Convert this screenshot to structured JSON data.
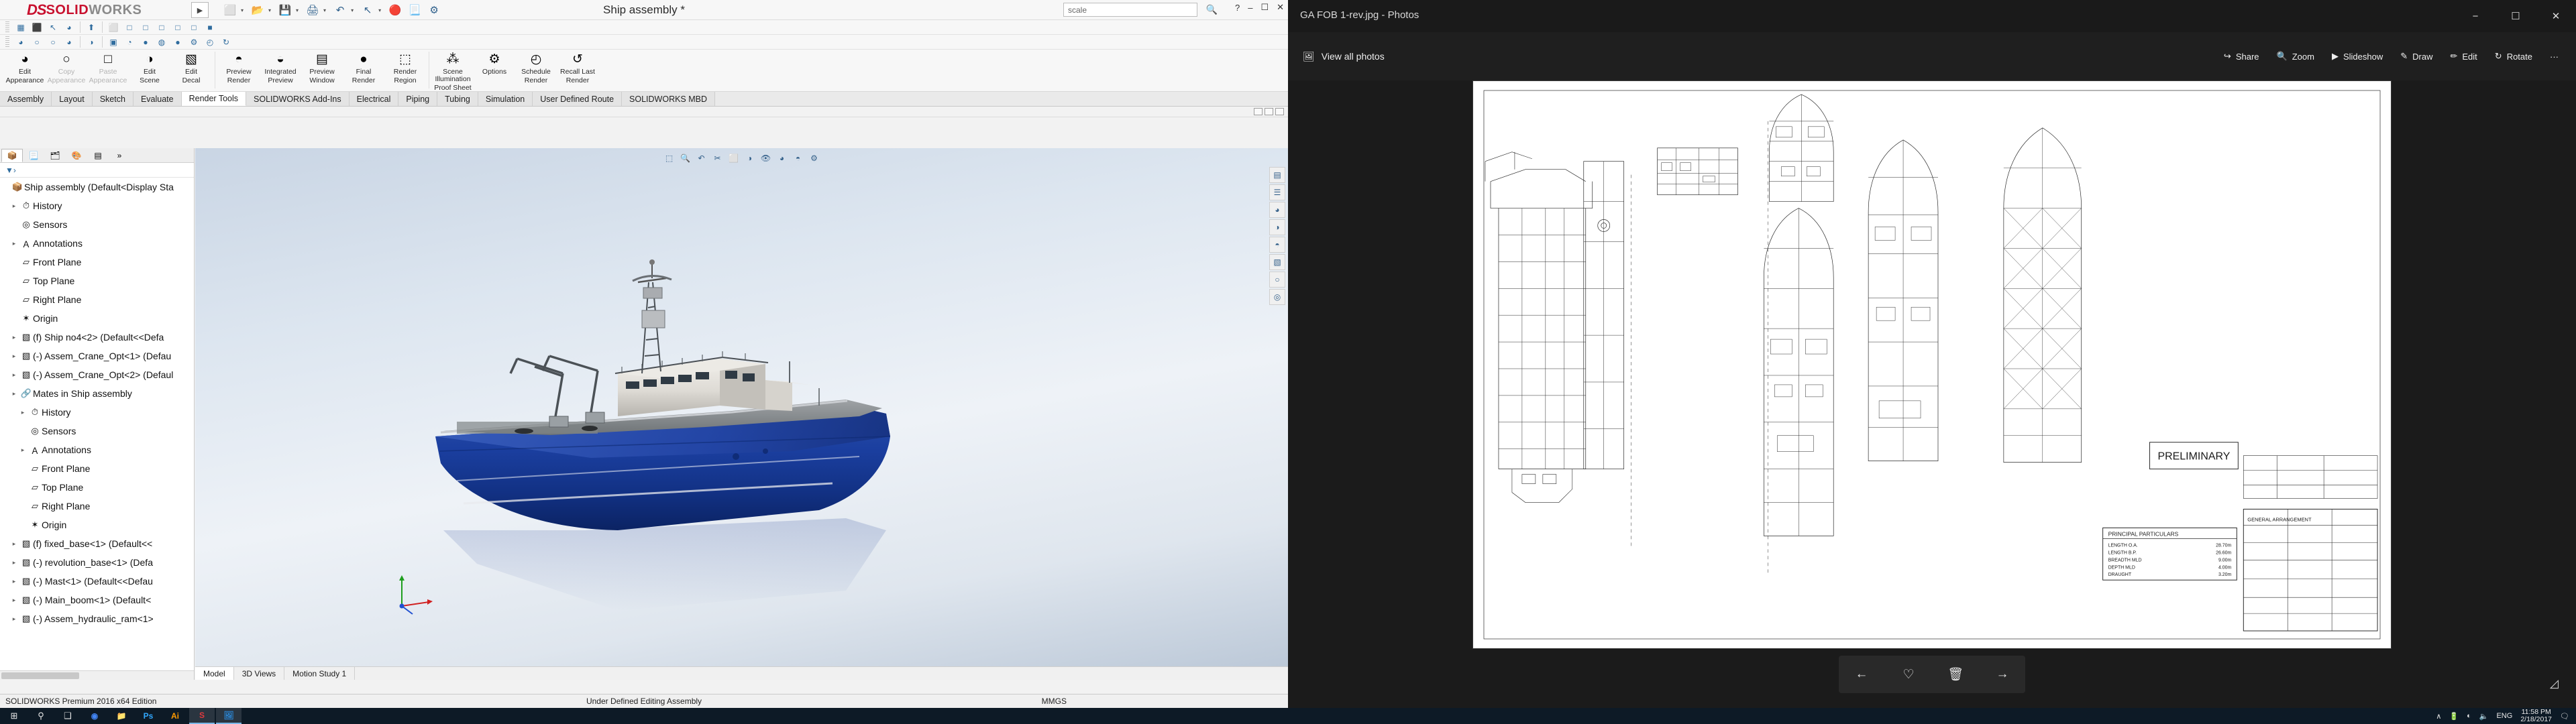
{
  "solidworks": {
    "title": "Ship assembly *",
    "logo": {
      "ds": "DS",
      "solid": "SOLID",
      "works": "WORKS"
    },
    "search_placeholder": "scale",
    "search_value": "scale",
    "window_buttons": [
      "?",
      "-",
      "❐",
      "✕"
    ],
    "quick_access": [
      {
        "name": "new-document-icon",
        "glyph": "⬜"
      },
      {
        "name": "open-document-icon",
        "glyph": "📂"
      },
      {
        "name": "save-icon",
        "glyph": "💾"
      },
      {
        "name": "print-icon",
        "glyph": "🖨"
      },
      {
        "name": "undo-icon",
        "glyph": "↶"
      },
      {
        "name": "select-icon",
        "glyph": "↖"
      },
      {
        "name": "rebuild-icon",
        "glyph": "🔴"
      },
      {
        "name": "options-list-icon",
        "glyph": "📃"
      },
      {
        "name": "settings-gear-icon",
        "glyph": "⚙"
      }
    ],
    "toolbar_row1": [
      "open-assembly-icon",
      "insert-component-icon",
      "select-pointer-icon",
      "appearance-icon",
      "normal-to-icon",
      "view-iso-icon",
      "view-front-icon",
      "view-left-icon",
      "view-right-icon",
      "view-top-icon",
      "view-bottom-icon",
      "view-shaded-icon"
    ],
    "toolbar_row2": [
      "appearance-edit-icon",
      "sphere-dim-icon",
      "bucket-dim-icon",
      "apply-appearance-icon",
      "scene-edit-icon",
      "display-state-icon",
      "scene-light-icon",
      "camera-icon",
      "lighting-icon",
      "two-spheres-icon",
      "render-settings-icon",
      "render-clock-icon",
      "render-refresh-icon"
    ],
    "ribbon": [
      {
        "label_top": "Edit",
        "label_bot": "Appearance",
        "icon": "appearance-icon",
        "dim": false
      },
      {
        "label_top": "Copy",
        "label_bot": "Appearance",
        "icon": "copy-appearance-icon",
        "dim": true
      },
      {
        "label_top": "Paste",
        "label_bot": "Appearance",
        "icon": "paste-appearance-icon",
        "dim": true
      },
      {
        "label_top": "Edit",
        "label_bot": "Scene",
        "icon": "edit-scene-icon",
        "dim": false
      },
      {
        "label_top": "Edit",
        "label_bot": "Decal",
        "icon": "edit-decal-icon",
        "dim": false
      },
      {
        "label_top": "Preview",
        "label_bot": "Render",
        "icon": "preview-render-icon",
        "dim": false
      },
      {
        "label_top": "Integrated",
        "label_bot": "Preview",
        "icon": "integrated-preview-icon",
        "dim": false
      },
      {
        "label_top": "Preview",
        "label_bot": "Window",
        "icon": "preview-window-icon",
        "dim": false
      },
      {
        "label_top": "Final",
        "label_bot": "Render",
        "icon": "final-render-icon",
        "dim": false
      },
      {
        "label_top": "Render",
        "label_bot": "Region",
        "icon": "render-region-icon",
        "dim": false
      },
      {
        "label_top": "Scene Illumination",
        "label_bot": "Proof Sheet",
        "icon": "proof-sheet-icon",
        "dim": false
      },
      {
        "label_top": "Options",
        "label_bot": "",
        "icon": "render-options-icon",
        "dim": false
      },
      {
        "label_top": "Schedule",
        "label_bot": "Render",
        "icon": "schedule-render-icon",
        "dim": false
      },
      {
        "label_top": "Recall Last",
        "label_bot": "Render",
        "icon": "recall-render-icon",
        "dim": false
      }
    ],
    "command_tabs": [
      {
        "label": "Assembly",
        "active": false
      },
      {
        "label": "Layout",
        "active": false
      },
      {
        "label": "Sketch",
        "active": false
      },
      {
        "label": "Evaluate",
        "active": false
      },
      {
        "label": "Render Tools",
        "active": true
      },
      {
        "label": "SOLIDWORKS Add-Ins",
        "active": false
      },
      {
        "label": "Electrical",
        "active": false
      },
      {
        "label": "Piping",
        "active": false
      },
      {
        "label": "Tubing",
        "active": false
      },
      {
        "label": "Simulation",
        "active": false
      },
      {
        "label": "User Defined Route",
        "active": false
      },
      {
        "label": "SOLIDWORKS MBD",
        "active": false
      }
    ],
    "tree_tabs": [
      {
        "name": "feature-manager-tab",
        "glyph": "📦",
        "active": true
      },
      {
        "name": "property-manager-tab",
        "glyph": "📃",
        "active": false
      },
      {
        "name": "configuration-manager-tab",
        "glyph": "🗂",
        "active": false
      },
      {
        "name": "display-manager-tab",
        "glyph": "🎨",
        "active": false
      },
      {
        "name": "dimxpert-tab",
        "glyph": "▤",
        "active": false
      },
      {
        "name": "tree-more-tab",
        "glyph": "»",
        "active": false
      }
    ],
    "tree_filter_placeholder": "",
    "tree": [
      {
        "indent": 0,
        "arrow": "",
        "icon": "assembly-icon",
        "label": "Ship assembly  (Default<Display Sta"
      },
      {
        "indent": 1,
        "arrow": "▸",
        "icon": "history-icon",
        "label": "History"
      },
      {
        "indent": 1,
        "arrow": "",
        "icon": "sensors-icon",
        "label": "Sensors"
      },
      {
        "indent": 1,
        "arrow": "▸",
        "icon": "annotations-icon",
        "label": "Annotations"
      },
      {
        "indent": 1,
        "arrow": "",
        "icon": "plane-icon",
        "label": "Front Plane"
      },
      {
        "indent": 1,
        "arrow": "",
        "icon": "plane-icon",
        "label": "Top Plane"
      },
      {
        "indent": 1,
        "arrow": "",
        "icon": "plane-icon",
        "label": "Right Plane"
      },
      {
        "indent": 1,
        "arrow": "",
        "icon": "origin-icon",
        "label": "Origin"
      },
      {
        "indent": 1,
        "arrow": "▸",
        "icon": "part-icon",
        "label": "(f) Ship no4<2>  (Default<<Defa"
      },
      {
        "indent": 1,
        "arrow": "▸",
        "icon": "part-icon",
        "label": "(-) Assem_Crane_Opt<1>  (Defau"
      },
      {
        "indent": 1,
        "arrow": "▸",
        "icon": "part-icon",
        "label": "(-) Assem_Crane_Opt<2>  (Defaul"
      },
      {
        "indent": 1,
        "arrow": "▸",
        "icon": "mates-icon",
        "label": "Mates in Ship assembly"
      },
      {
        "indent": 2,
        "arrow": "▸",
        "icon": "history-icon",
        "label": "History"
      },
      {
        "indent": 2,
        "arrow": "",
        "icon": "sensors-icon",
        "label": "Sensors"
      },
      {
        "indent": 2,
        "arrow": "▸",
        "icon": "annotations-icon",
        "label": "Annotations"
      },
      {
        "indent": 2,
        "arrow": "",
        "icon": "plane-icon",
        "label": "Front Plane"
      },
      {
        "indent": 2,
        "arrow": "",
        "icon": "plane-icon",
        "label": "Top Plane"
      },
      {
        "indent": 2,
        "arrow": "",
        "icon": "plane-icon",
        "label": "Right Plane"
      },
      {
        "indent": 2,
        "arrow": "",
        "icon": "origin-icon",
        "label": "Origin"
      },
      {
        "indent": 1,
        "arrow": "▸",
        "icon": "part-icon",
        "label": "(f) fixed_base<1>  (Default<<"
      },
      {
        "indent": 1,
        "arrow": "▸",
        "icon": "part-icon",
        "label": "(-) revolution_base<1>  (Defa"
      },
      {
        "indent": 1,
        "arrow": "▸",
        "icon": "part-icon",
        "label": "(-) Mast<1>  (Default<<Defau"
      },
      {
        "indent": 1,
        "arrow": "▸",
        "icon": "part-icon",
        "label": "(-) Main_boom<1>  (Default<"
      },
      {
        "indent": 1,
        "arrow": "▸",
        "icon": "part-icon",
        "label": "(-) Assem_hydraulic_ram<1> "
      }
    ],
    "viewport_tabs": [
      {
        "label": "Model",
        "active": true
      },
      {
        "label": "3D Views",
        "active": false
      },
      {
        "label": "Motion Study 1",
        "active": false
      }
    ],
    "status": {
      "left": "SOLIDWORKS Premium 2016 x64 Edition",
      "center": "Under Defined     Editing Assembly",
      "units": "MMGS"
    }
  },
  "photos": {
    "title": "GA FOB 1-rev.jpg - Photos",
    "window_buttons": [
      "−",
      "❐",
      "✕"
    ],
    "view_all_label": "View all photos",
    "view_all_icon": "photo-collection-icon",
    "actions": [
      {
        "label": "Share",
        "icon": "share-icon"
      },
      {
        "label": "Zoom",
        "icon": "zoom-icon"
      },
      {
        "label": "Slideshow",
        "icon": "slideshow-icon"
      },
      {
        "label": "Draw",
        "icon": "draw-icon"
      },
      {
        "label": "Edit",
        "icon": "edit-icon"
      },
      {
        "label": "Rotate",
        "icon": "rotate-icon"
      },
      {
        "label": "···",
        "icon": "more-icon"
      }
    ],
    "nav": [
      {
        "name": "previous-image-button",
        "glyph": "←"
      },
      {
        "name": "favorite-button",
        "glyph": "♡"
      },
      {
        "name": "delete-button",
        "glyph": "🗑"
      },
      {
        "name": "next-image-button",
        "glyph": "→"
      }
    ],
    "expand_icon": "expand-icon",
    "drawing": {
      "stamp": "PRELIMINARY",
      "particulars_title": "PRINCIPAL PARTICULARS",
      "particulars": [
        {
          "k": "LENGTH O.A.",
          "v": "28.70m"
        },
        {
          "k": "LENGTH B.P.",
          "v": "26.60m"
        },
        {
          "k": "BREADTH MLD",
          "v": "9.00m"
        },
        {
          "k": "DEPTH MLD",
          "v": "4.00m"
        },
        {
          "k": "DRAUGHT",
          "v": "3.20m"
        }
      ],
      "titleblock_note": "GENERAL ARRANGEMENT"
    }
  },
  "taskbar": {
    "start_icon": "windows-start-icon",
    "search_icon": "search-icon",
    "taskview_icon": "task-view-icon",
    "apps": [
      {
        "name": "chrome-icon",
        "glyph": "◉",
        "color": "#4285f4",
        "active": false
      },
      {
        "name": "file-explorer-icon",
        "glyph": "📁",
        "color": "#ffc83d",
        "active": false
      },
      {
        "name": "photoshop-icon",
        "glyph": "Ps",
        "color": "#31a8ff",
        "active": false
      },
      {
        "name": "illustrator-icon",
        "glyph": "Ai",
        "color": "#ff9a00",
        "active": false
      },
      {
        "name": "solidworks-icon",
        "glyph": "S",
        "color": "#e03a3e",
        "active": true
      },
      {
        "name": "photos-icon",
        "glyph": "🖼",
        "color": "#2b88d8",
        "active": true
      }
    ],
    "tray": {
      "chevron": "∧",
      "battery_icon": "battery-icon",
      "network_icon": "wifi-icon",
      "volume_icon": "volume-icon",
      "language": "ENG",
      "time": "11:58 PM",
      "date": "2/18/2017",
      "action_center_icon": "notification-icon"
    }
  }
}
